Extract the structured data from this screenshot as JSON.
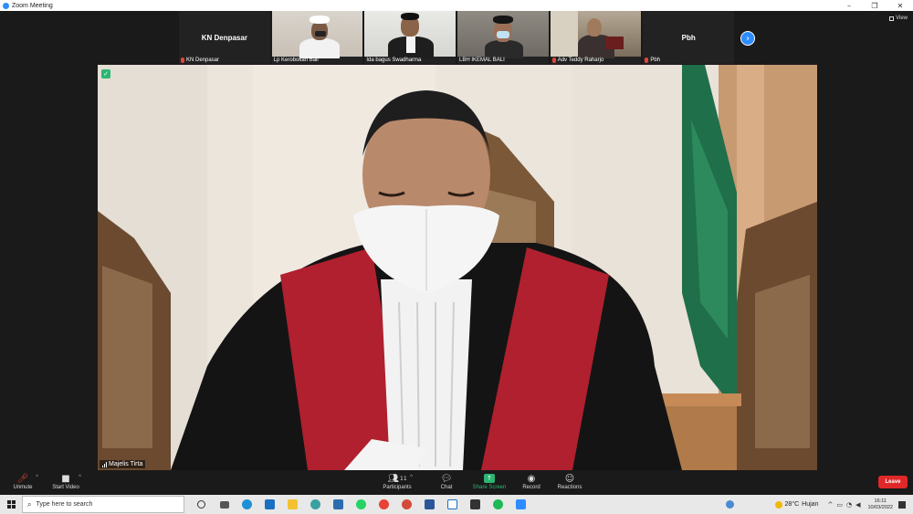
{
  "window": {
    "title": "Zoom Meeting"
  },
  "thumbnails": [
    {
      "name": "KN Denpasar",
      "display_name": "KN Denpasar",
      "video": false,
      "muted": true
    },
    {
      "name": "Lp Kerobokan Bali",
      "video": true,
      "muted": false
    },
    {
      "name": "Ida bagus Swadharma",
      "video": true,
      "muted": false
    },
    {
      "name": "LBH IKEMAL BALI",
      "video": true,
      "muted": false
    },
    {
      "name": "Adv Teddy Raharjo",
      "video": true,
      "muted": true
    },
    {
      "name": "Pbh",
      "display_name": "Pbh",
      "video": false,
      "muted": true
    }
  ],
  "view_label": "View",
  "main": {
    "speaker_name": "Majelis Tirta"
  },
  "controls": {
    "unmute": "Unmute",
    "start_video": "Start Video",
    "participants": "Participants",
    "participants_count": "11",
    "chat": "Chat",
    "share_screen": "Share Screen",
    "record": "Record",
    "reactions": "Reactions",
    "leave": "Leave"
  },
  "taskbar": {
    "search_placeholder": "Type here to search",
    "weather_temp": "28°C",
    "weather_desc": "Hujan",
    "time": "16:11",
    "date": "10/03/2022"
  },
  "colors": {
    "zoom_blue": "#2d8cff",
    "share_green": "#2bb673",
    "leave_red": "#e02828",
    "mute_red": "#e0463a"
  }
}
